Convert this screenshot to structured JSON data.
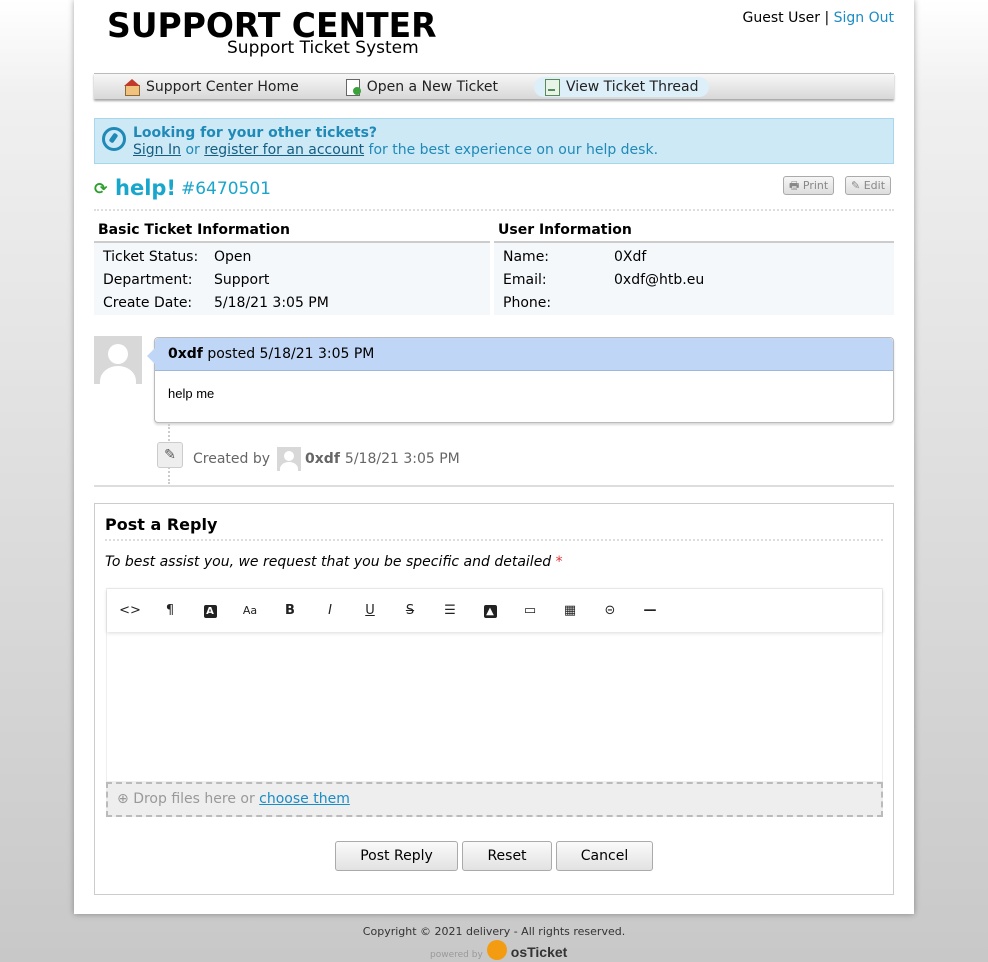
{
  "header": {
    "logo_title": "SUPPORT CENTER",
    "logo_subtitle": "Support Ticket System",
    "user_name": "Guest User",
    "separator": "|",
    "sign_out": "Sign Out"
  },
  "nav": {
    "items": [
      {
        "label": "Support Center Home",
        "icon": "home-icon"
      },
      {
        "label": "Open a New Ticket",
        "icon": "new-ticket-icon"
      },
      {
        "label": "View Ticket Thread",
        "icon": "ticket-thread-icon",
        "active": true
      }
    ]
  },
  "notice": {
    "title": "Looking for your other tickets?",
    "sign_in": "Sign In",
    "or": "or",
    "register": "register for an account",
    "tail": "for the best experience on our help desk."
  },
  "ticket": {
    "subject": "help!",
    "number": "#6470501",
    "print_label": "Print",
    "edit_label": "Edit",
    "basic_heading": "Basic Ticket Information",
    "user_heading": "User Information",
    "basic": [
      {
        "label": "Ticket Status:",
        "value": "Open"
      },
      {
        "label": "Department:",
        "value": "Support"
      },
      {
        "label": "Create Date:",
        "value": "5/18/21 3:05 PM"
      }
    ],
    "user": [
      {
        "label": "Name:",
        "value": "0Xdf"
      },
      {
        "label": "Email:",
        "value": "0xdf@htb.eu"
      },
      {
        "label": "Phone:",
        "value": ""
      }
    ]
  },
  "thread": {
    "poster": "0xdf",
    "posted_text": "posted",
    "posted_time": "5/18/21 3:05 PM",
    "body": "help me",
    "event_prefix": "Created by",
    "event_user": "0xdf",
    "event_time": "5/18/21 3:05 PM"
  },
  "reply": {
    "title": "Post a Reply",
    "instructions": "To best assist you, we request that you be specific and detailed",
    "required_mark": "*",
    "toolbar": [
      "code-view-icon",
      "paragraph-icon",
      "text-color-icon",
      "font-size-icon",
      "bold-icon",
      "italic-icon",
      "underline-icon",
      "strikethrough-icon",
      "list-icon",
      "image-icon",
      "video-icon",
      "table-icon",
      "link-icon",
      "horizontal-rule-icon"
    ],
    "drop_text": "Drop files here or",
    "choose_link": "choose them",
    "post_button": "Post Reply",
    "reset_button": "Reset",
    "cancel_button": "Cancel"
  },
  "footer": {
    "copyright": "Copyright © 2021 delivery - All rights reserved.",
    "powered_by": "powered by",
    "brand": "osTicket"
  },
  "colors": {
    "accent": "#1b8cc4",
    "subject": "#19a6cc",
    "notice_bg": "#cde9f6",
    "message_header": "#c0d6f6"
  }
}
